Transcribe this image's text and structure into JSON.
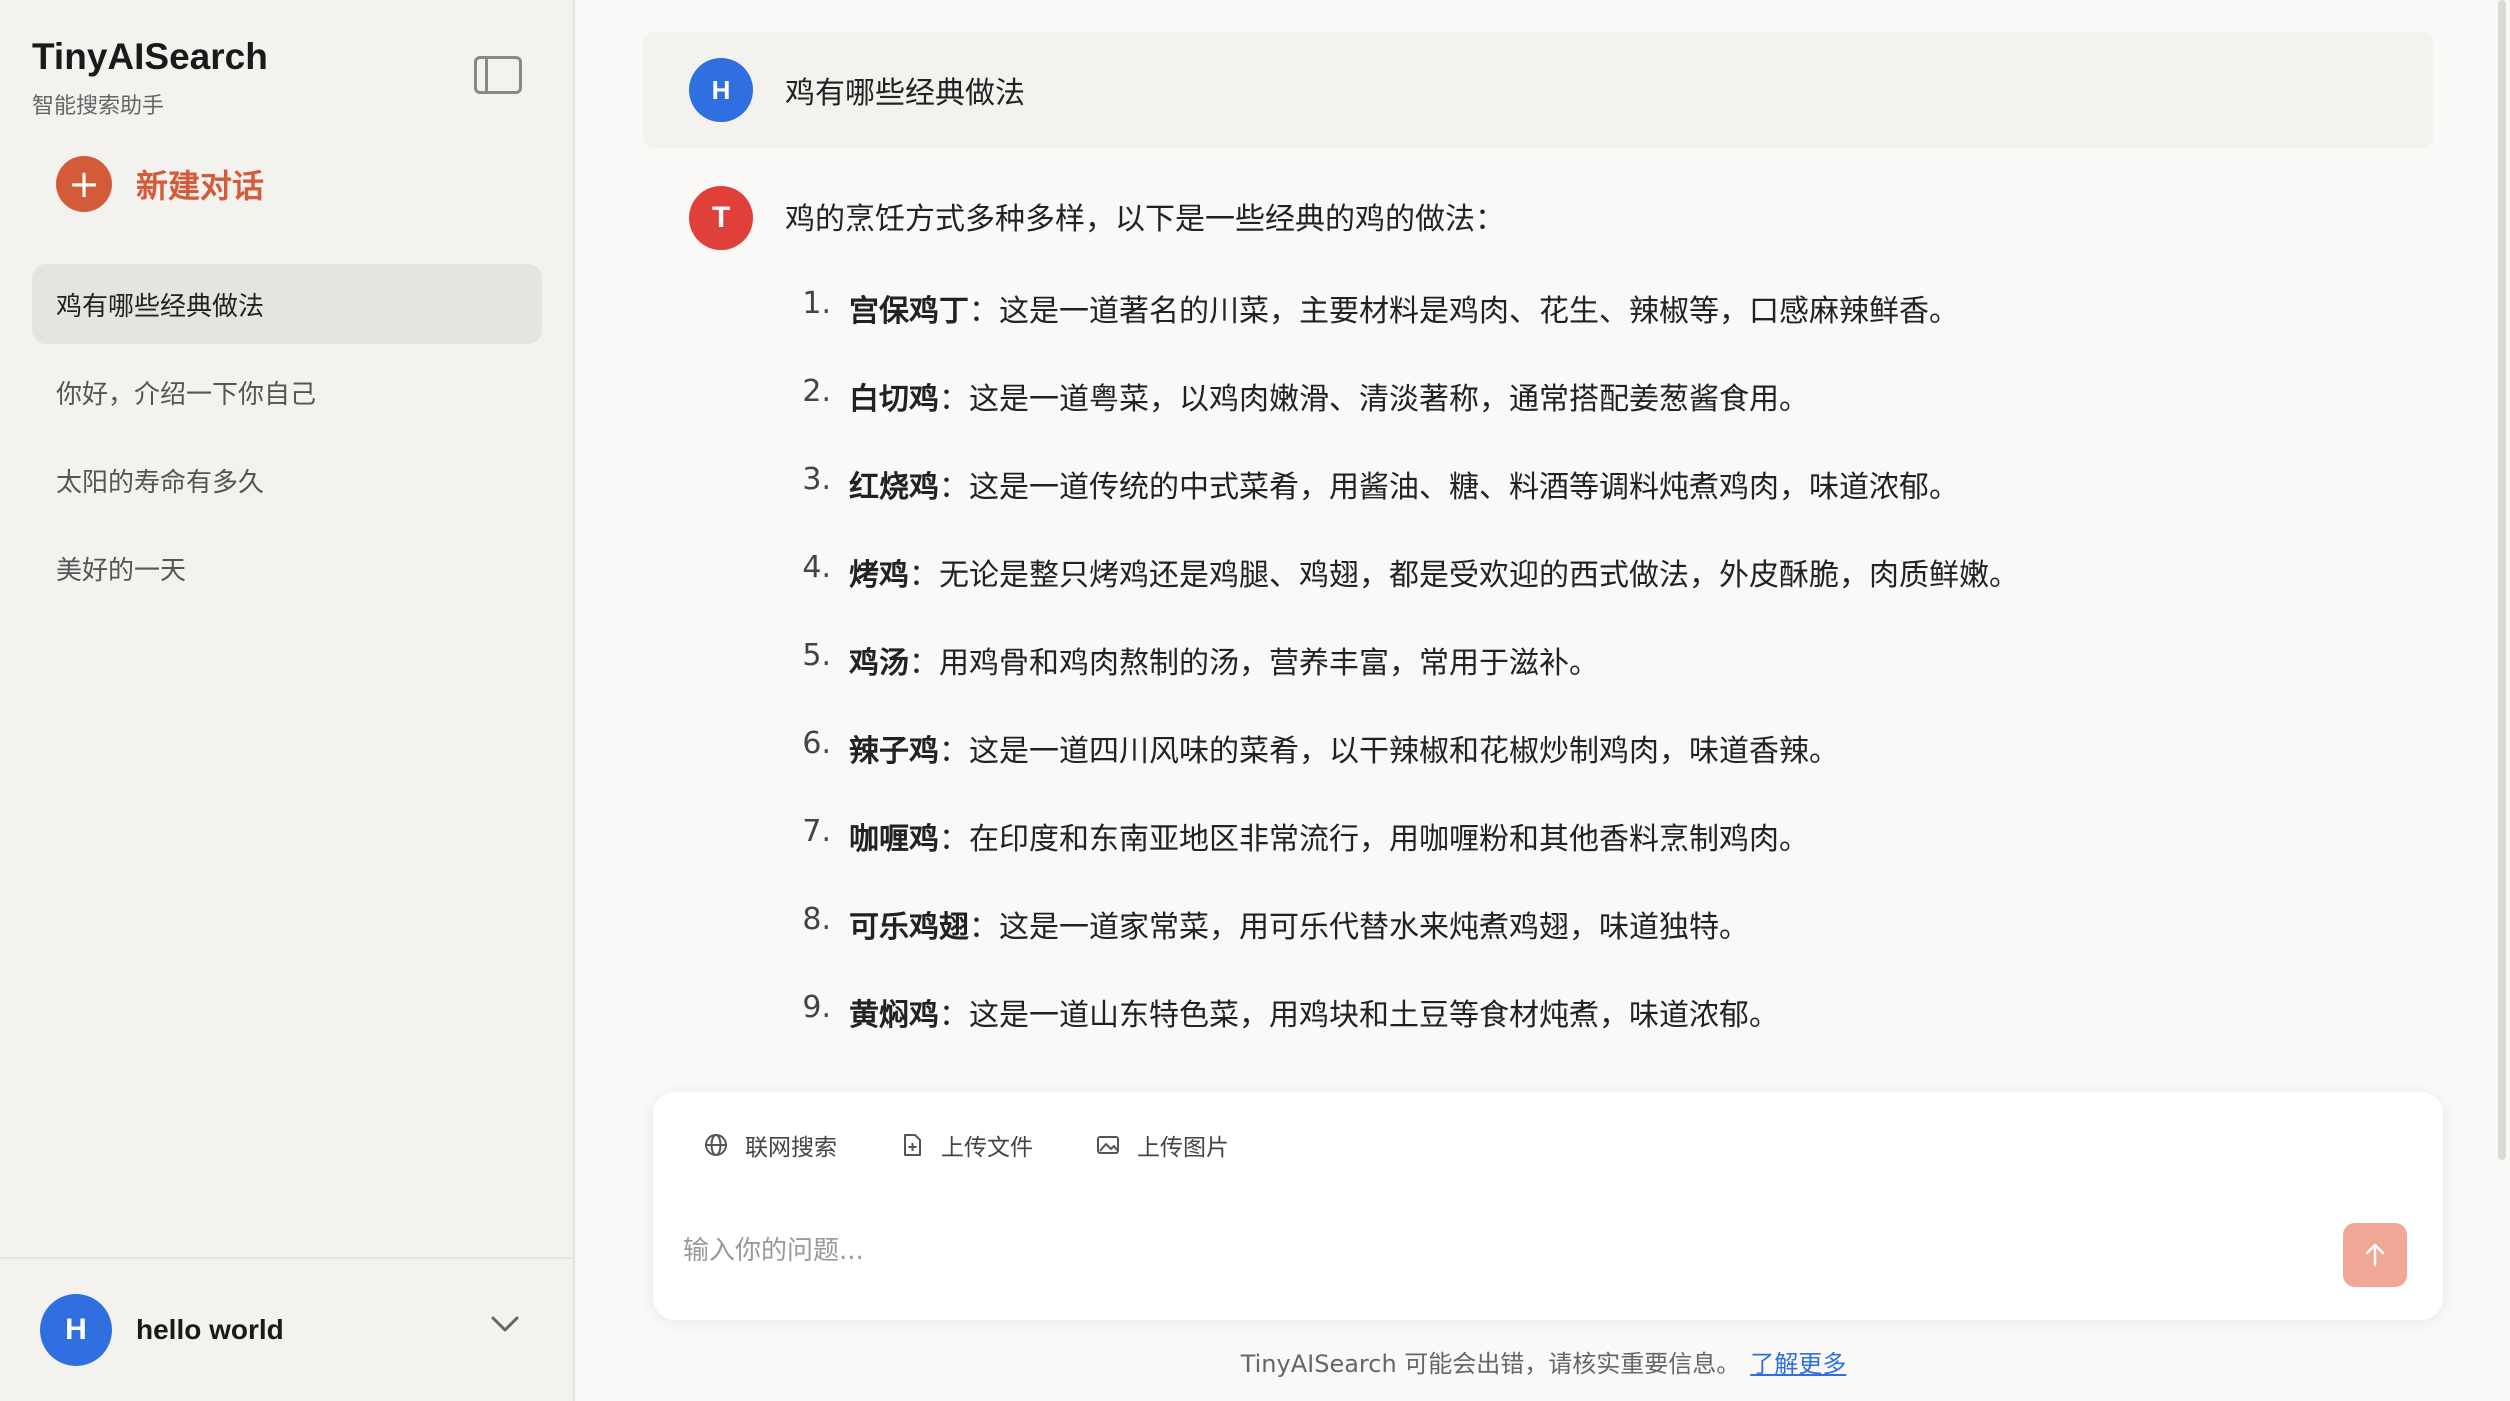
{
  "sidebar": {
    "brand_title": "TinyAISearch",
    "brand_subtitle": "智能搜索助手",
    "new_chat_label": "新建对话",
    "history": [
      {
        "label": "鸡有哪些经典做法",
        "active": true
      },
      {
        "label": "你好，介绍一下你自己",
        "active": false
      },
      {
        "label": "太阳的寿命有多久",
        "active": false
      },
      {
        "label": "美好的一天",
        "active": false
      }
    ],
    "user": {
      "initial": "H",
      "name": "hello world"
    }
  },
  "conversation": {
    "user_message": {
      "initial": "H",
      "text": "鸡有哪些经典做法"
    },
    "assistant": {
      "initial": "T",
      "intro": "鸡的烹饪方式多种多样，以下是一些经典的鸡的做法：",
      "items": [
        {
          "num": "1.",
          "term": "宫保鸡丁",
          "desc": "：这是一道著名的川菜，主要材料是鸡肉、花生、辣椒等，口感麻辣鲜香。"
        },
        {
          "num": "2.",
          "term": "白切鸡",
          "desc": "：这是一道粤菜，以鸡肉嫩滑、清淡著称，通常搭配姜葱酱食用。"
        },
        {
          "num": "3.",
          "term": "红烧鸡",
          "desc": "：这是一道传统的中式菜肴，用酱油、糖、料酒等调料炖煮鸡肉，味道浓郁。"
        },
        {
          "num": "4.",
          "term": "烤鸡",
          "desc": "：无论是整只烤鸡还是鸡腿、鸡翅，都是受欢迎的西式做法，外皮酥脆，肉质鲜嫩。"
        },
        {
          "num": "5.",
          "term": "鸡汤",
          "desc": "：用鸡骨和鸡肉熬制的汤，营养丰富，常用于滋补。"
        },
        {
          "num": "6.",
          "term": "辣子鸡",
          "desc": "：这是一道四川风味的菜肴，以干辣椒和花椒炒制鸡肉，味道香辣。"
        },
        {
          "num": "7.",
          "term": "咖喱鸡",
          "desc": "：在印度和东南亚地区非常流行，用咖喱粉和其他香料烹制鸡肉。"
        },
        {
          "num": "8.",
          "term": "可乐鸡翅",
          "desc": "：这是一道家常菜，用可乐代替水来炖煮鸡翅，味道独特。"
        },
        {
          "num": "9.",
          "term": "黄焖鸡",
          "desc": "：这是一道山东特色菜，用鸡块和土豆等食材炖煮，味道浓郁。"
        }
      ]
    }
  },
  "composer": {
    "tools": [
      {
        "icon": "globe-icon",
        "label": "联网搜索"
      },
      {
        "icon": "file-upload-icon",
        "label": "上传文件"
      },
      {
        "icon": "image-icon",
        "label": "上传图片"
      }
    ],
    "placeholder": "输入你的问题...",
    "send_icon": "arrow-up-icon"
  },
  "footer": {
    "disclaimer": "TinyAISearch 可能会出错，请核实重要信息。",
    "link": "了解更多"
  },
  "colors": {
    "accent": "#d35b3a",
    "user_avatar": "#2f6fe0",
    "assistant_avatar": "#e0403a",
    "send_button": "#f0a796",
    "link": "#2f6fe0"
  }
}
